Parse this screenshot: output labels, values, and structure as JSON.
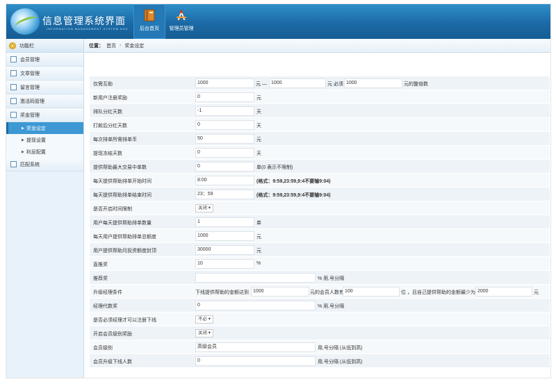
{
  "header": {
    "title": "信息管理系统界面",
    "subtitle": "INFORMATION MANAGEMENT SYSTEM BOX",
    "nav": [
      {
        "label": "后台首页",
        "icon": "book-icon"
      },
      {
        "label": "管理员管理",
        "icon": "compass-icon"
      }
    ]
  },
  "sidebar": {
    "title": "功能栏",
    "menus": [
      {
        "label": "会员管理"
      },
      {
        "label": "文章管理"
      },
      {
        "label": "留言管理"
      },
      {
        "label": "激活码管理"
      },
      {
        "label": "奖金管理"
      },
      {
        "label": "匹配系统"
      }
    ],
    "submenus": [
      {
        "label": "奖金设定"
      },
      {
        "label": "提现设置"
      },
      {
        "label": "利息配置"
      }
    ]
  },
  "breadcrumb": {
    "prefix": "位置：",
    "home": "首页",
    "current": "奖金设定"
  },
  "form": {
    "r1": {
      "label": "仅需互助",
      "v1": "1000",
      "t1": "元 —",
      "v2": "1000",
      "t2": "元 必须",
      "v3": "1000",
      "t3": "元的整倍数"
    },
    "r2": {
      "label": "新用户注册奖励",
      "v": "0",
      "unit": "元"
    },
    "r3": {
      "label": "排队分红天数",
      "v": "-1",
      "unit": "天"
    },
    "r4": {
      "label": "打款后分红天数",
      "v": "0",
      "unit": "天"
    },
    "r5": {
      "label": "每次排单所需排单币",
      "v": "50",
      "unit": "元"
    },
    "r6": {
      "label": "提现冻结天数",
      "v": "0",
      "unit": "天"
    },
    "r7": {
      "label": "提供帮助最大交易中单数",
      "v": "0",
      "unit": "单(0 表示不限制)"
    },
    "r8": {
      "label": "每天提供帮助排单开始时间",
      "v": "8:00",
      "unit": "(格式：9:59,23:59,9:4不要输9:04)"
    },
    "r9": {
      "label": "每天提供帮助排单结束时间",
      "v": "23：59",
      "unit": "(格式：9:59,23:59,9:4不要输9:04)"
    },
    "r10": {
      "label": "是否开启时间限制",
      "select": "关闭 ▾"
    },
    "r11": {
      "label": "用户每天提供帮助排单数量",
      "v": "1",
      "unit": "单"
    },
    "r12": {
      "label": "每天用户提供帮助排单总额度",
      "v": "1000",
      "unit": "元"
    },
    "r13": {
      "label": "用户提供帮助月投资额度封顶",
      "v": "30000",
      "unit": "元"
    },
    "r14": {
      "label": "直推奖",
      "v": "10",
      "unit": "%"
    },
    "r15": {
      "label": "推荐奖",
      "v": "",
      "unit": "% 用,号分隔"
    },
    "r16": {
      "label": "升级经理条件",
      "t1": "下线提供帮助的金额达到",
      "v1": "1000",
      "t2": "元的会员人数有",
      "v2": "100",
      "t3": "位 ，且自己提供帮助的金额最少为",
      "v3": "2000",
      "t4": "元"
    },
    "r17": {
      "label": "经理代数奖",
      "v": "0",
      "unit": "% 用,号分隔"
    },
    "r18": {
      "label": "是否必须经理才可以注册下线",
      "select": "不必 ▾"
    },
    "r19": {
      "label": "开启会员级别奖励",
      "select": "关闭 ▾"
    },
    "r20": {
      "label": "会员级别",
      "v": "高级会员",
      "unit": "用,号分隔 (从低到高)"
    },
    "r21": {
      "label": "会员升级下线人数",
      "v": "0",
      "unit": "用,号分隔 (从低到高)"
    }
  }
}
